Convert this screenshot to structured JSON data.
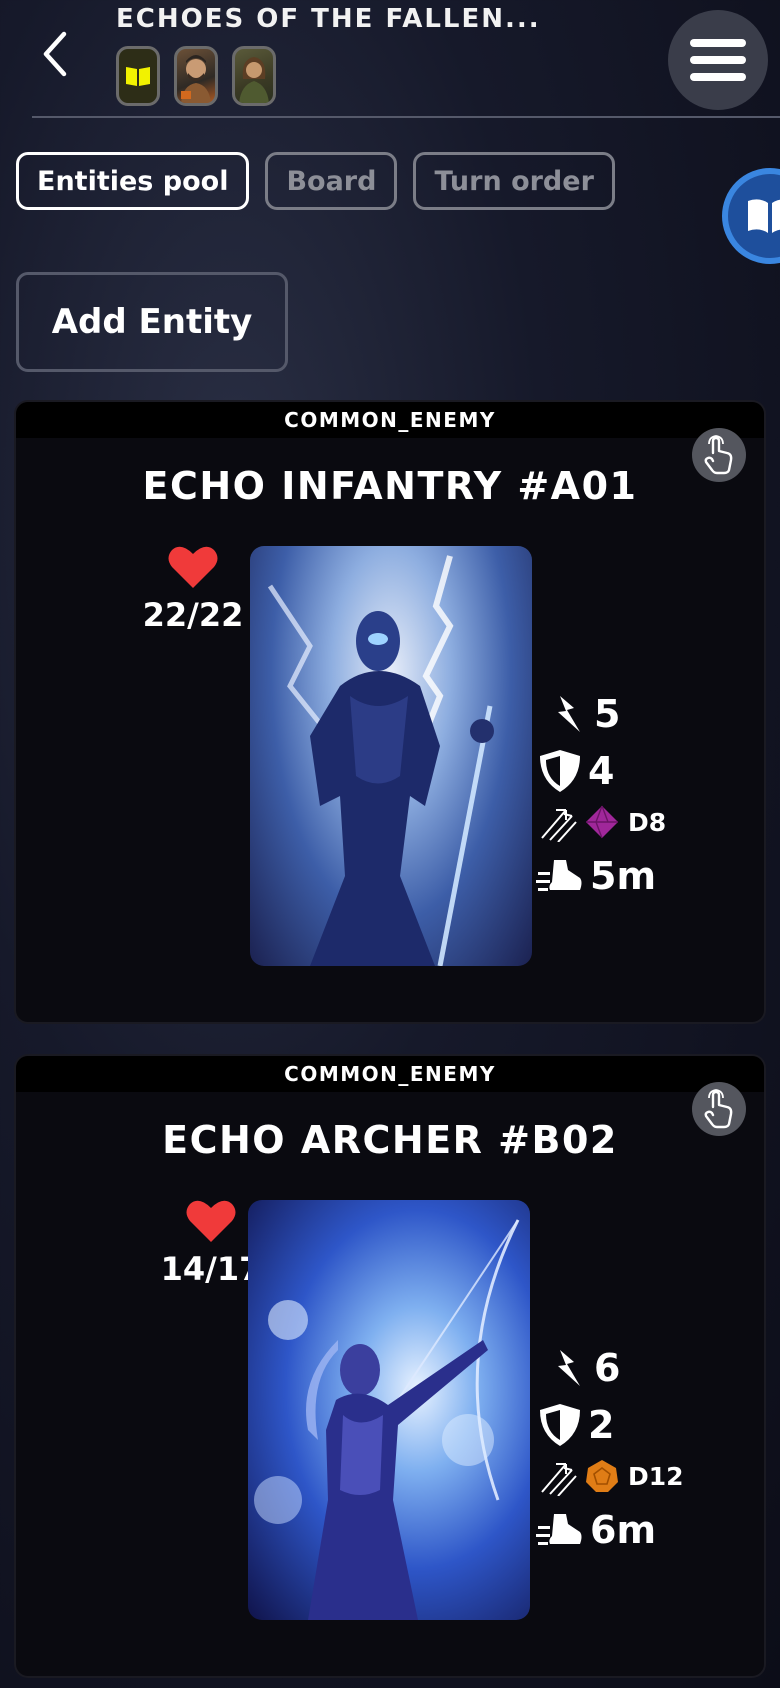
{
  "header": {
    "title": "ECHOES OF THE FALLEN...",
    "back_icon": "chevron-left-icon",
    "menu_icon": "hamburger-menu-icon",
    "avatars": [
      "rulebook-avatar",
      "player-avatar-warrior",
      "player-avatar-ranger"
    ]
  },
  "tabs": [
    {
      "label": "Entities pool",
      "active": true
    },
    {
      "label": "Board",
      "active": false
    },
    {
      "label": "Turn order",
      "active": false
    }
  ],
  "add_entity_label": "Add Entity",
  "entities": [
    {
      "type": "COMMON_ENEMY",
      "name": "ECHO INFANTRY #A01",
      "hp": "22/22",
      "attack": "5",
      "defense": "4",
      "dice": "D8",
      "dice_color": "#a0279a",
      "speed": "5m"
    },
    {
      "type": "COMMON_ENEMY",
      "name": "ECHO ARCHER #B02",
      "hp": "14/17",
      "attack": "6",
      "defense": "2",
      "dice": "D12",
      "dice_color": "#e07d16",
      "speed": "6m"
    }
  ],
  "colors": {
    "heart": "#f03a3a",
    "fab": "#1e4f9c",
    "accent_border": "#ffffff"
  }
}
